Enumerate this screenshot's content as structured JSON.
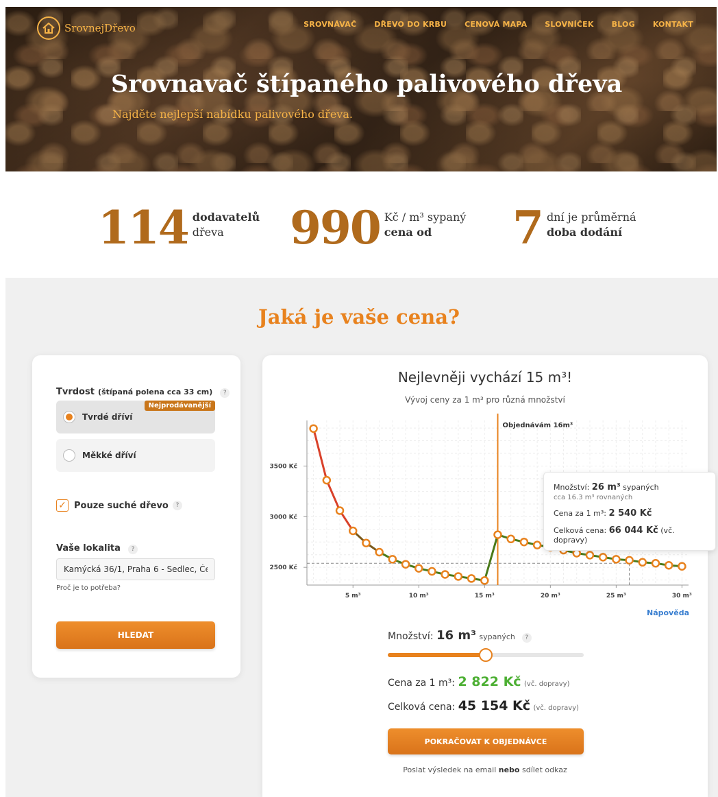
{
  "header": {
    "logo_text": "SrovnejDřevo",
    "nav": [
      "SROVNÁVAČ",
      "DŘEVO DO KRBU",
      "CENOVÁ MAPA",
      "SLOVNÍČEK",
      "BLOG",
      "KONTAKT"
    ],
    "title": "Srovnavač štípaného palivového dřeva",
    "subtitle": "Najděte nejlepší nabídku palivového dřeva."
  },
  "stats": [
    {
      "number": "114",
      "line1": "dodavatelů",
      "line2": "dřeva"
    },
    {
      "number": "990",
      "line1": "Kč / m³ sypaný",
      "line2": "cena od"
    },
    {
      "number": "7",
      "line1": "dní je průměrná",
      "line2": "doba dodání"
    }
  ],
  "section_title": "Jaká je vaše cena?",
  "form": {
    "hardness_label": "Tvrdost",
    "hardness_note": "(štípaná polena cca 33 cm)",
    "help_mark": "?",
    "option_hard": "Tvrdé dříví",
    "option_soft": "Měkké dříví",
    "bestseller_badge": "Nejprodávanější",
    "dry_only_label": "Pouze suché dřevo",
    "location_label": "Vaše lokalita",
    "location_value": "Kamýcká 36/1, Praha 6 - Sedlec, Česko",
    "why_link": "Proč je to potřeba?",
    "search_button": "HLEDAT"
  },
  "result": {
    "title": "Nejlevněji vychází 15 m³!",
    "subtitle": "Vývoj ceny za 1 m³ pro různá množství",
    "order_marker_label": "Objednávám 16m³",
    "help_link": "Nápověda",
    "tooltip": {
      "qty_label": "Množství:",
      "qty_value": "26 m³",
      "qty_unit": "sypaných",
      "qty_note": "cca 16.3 m³ rovnaných",
      "unit_price_label": "Cena za 1 m³:",
      "unit_price_value": "2 540 Kč",
      "total_label": "Celková cena:",
      "total_value": "66 044 Kč",
      "total_note": "(vč. dopravy)"
    },
    "quantity_label": "Množství:",
    "quantity_value": "16 m³",
    "quantity_unit": "sypaných",
    "slider_fraction": 0.5,
    "unit_price_label": "Cena za 1 m³:",
    "unit_price_value": "2 822 Kč",
    "price_note": "(vč. dopravy)",
    "total_label": "Celková cena:",
    "total_value": "45 154 Kč",
    "order_button": "POKRAČOVAT K OBJEDNÁVCE",
    "share_prefix": "Poslat výsledek na email",
    "share_or": "nebo",
    "share_link": "sdílet odkaz"
  },
  "chart_data": {
    "type": "line",
    "title": "Vývoj ceny za 1 m³ pro různá množství",
    "x_ticks": [
      "5 m³",
      "10 m³",
      "15 m³",
      "20 m³",
      "25 m³",
      "30 m³"
    ],
    "y_ticks": [
      "2500 Kč",
      "3000 Kč",
      "3500 Kč"
    ],
    "xlim": [
      1.5,
      30.5
    ],
    "ylim": [
      2325,
      3950
    ],
    "x": [
      2,
      3,
      4,
      5,
      6,
      7,
      8,
      9,
      10,
      11,
      12,
      13,
      14,
      15,
      16,
      17,
      18,
      19,
      20,
      21,
      22,
      23,
      24,
      25,
      26,
      27,
      28,
      29,
      30
    ],
    "values": [
      3870,
      3360,
      3060,
      2860,
      2740,
      2650,
      2580,
      2530,
      2490,
      2460,
      2430,
      2410,
      2390,
      2370,
      2822,
      2780,
      2750,
      2720,
      2700,
      2670,
      2640,
      2620,
      2600,
      2580,
      2570,
      2550,
      2540,
      2520,
      2510
    ],
    "selected_x": 16,
    "hover_x": 26,
    "hover_y": 2540,
    "line_colors": [
      "#d9412a",
      "#7a5a1c",
      "#4a7a1a"
    ],
    "marker_color": "#e8821e",
    "grid": true
  }
}
